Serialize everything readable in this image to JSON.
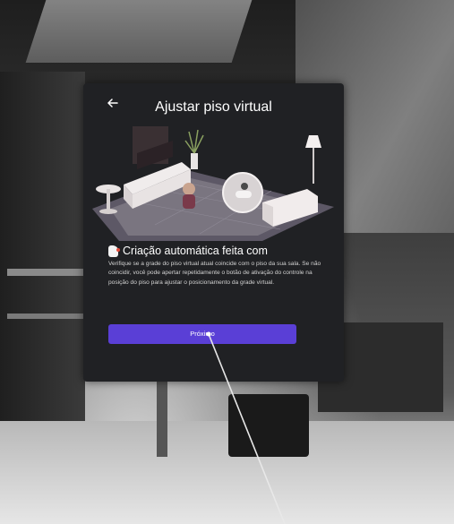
{
  "panel": {
    "title": "Ajustar piso virtual",
    "back_icon": "arrow-left-icon",
    "heading": "Criação automática feita com",
    "heading_icon": "hand-pointer-icon",
    "description": "Verifique se a grade do piso virtual atual coincide com o piso da sua sala. Se não coincidir, você pode apertar repetidamente o botão de ativação do controle na posição do piso para ajustar o posicionamento da grade virtual.",
    "next_label": "Próximo"
  },
  "colors": {
    "panel_bg": "#202124",
    "accent": "#5a3fd6",
    "floor_grid": "#6f6a77"
  }
}
